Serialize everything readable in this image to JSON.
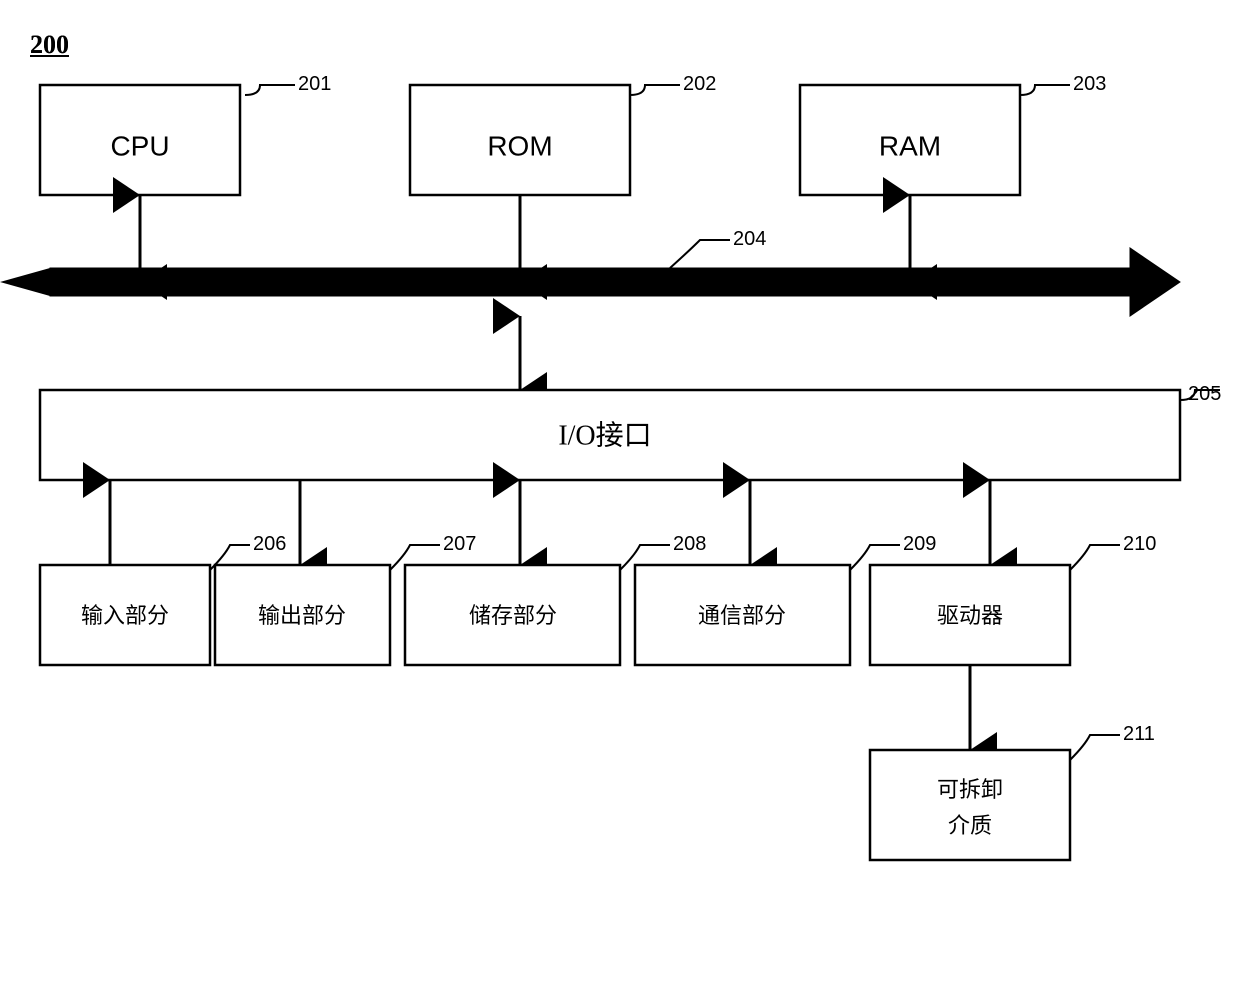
{
  "title": "200",
  "components": {
    "cpu": {
      "label": "CPU",
      "ref": "201"
    },
    "rom": {
      "label": "ROM",
      "ref": "202"
    },
    "ram": {
      "label": "RAM",
      "ref": "203"
    },
    "bus": {
      "ref": "204"
    },
    "io": {
      "label": "I/O接口",
      "ref": "205"
    },
    "input": {
      "label": "输入部分",
      "ref": "206"
    },
    "output": {
      "label": "输出部分",
      "ref": "207"
    },
    "storage": {
      "label": "储存部分",
      "ref": "208"
    },
    "comm": {
      "label": "通信部分",
      "ref": "209"
    },
    "driver": {
      "label": "驱动器",
      "ref": "210"
    },
    "removable": {
      "label": "可拆卸\n介质",
      "ref": "211"
    }
  }
}
